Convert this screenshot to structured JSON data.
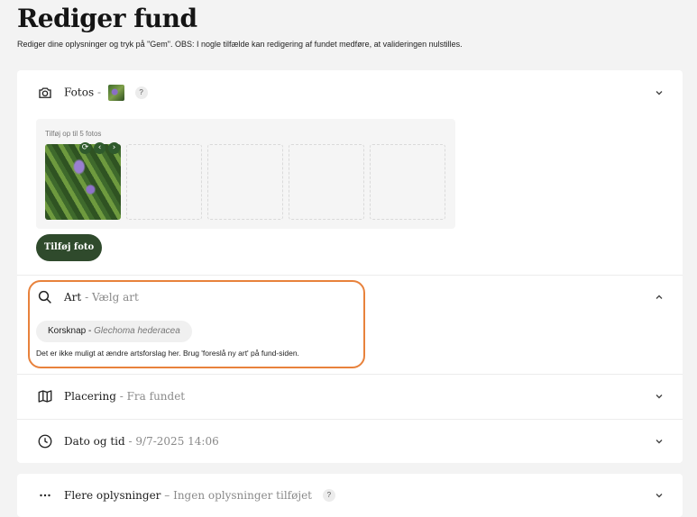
{
  "page": {
    "title": "Rediger fund",
    "subtitle": "Rediger dine oplysninger og tryk på \"Gem\". OBS: I nogle tilfælde kan redigering af fundet medføre, at valideringen nulstilles."
  },
  "photos": {
    "label": "Fotos",
    "separator": "-",
    "help": "?",
    "hint": "Tilføj op til 5 fotos",
    "max_photos": 5,
    "photo_count": 1,
    "add_button": "Tilføj foto",
    "icons": [
      "camera-icon",
      "refresh-icon",
      "chevron-left-icon",
      "chevron-right-icon",
      "chevron-down-icon"
    ]
  },
  "species": {
    "label": "Art",
    "separator": "-",
    "sub": "Vælg art",
    "common_name": "Korsknap",
    "chip_separator": " - ",
    "latin_name": "Glechoma hederacea",
    "note": "Det er ikke muligt at ændre artsforslag her. Brug 'foreslå ny art' på fund-siden.",
    "icon": "search-icon",
    "expanded": true
  },
  "location": {
    "label": "Placering",
    "separator": "-",
    "sub": "Fra fundet",
    "icon": "map-icon"
  },
  "datetime": {
    "label": "Dato og tid",
    "separator": "-",
    "sub": "9/7-2025 14:06",
    "icon": "clock-icon"
  },
  "more": {
    "label": "Flere oplysninger",
    "separator": "–",
    "sub": "Ingen oplysninger tilføjet",
    "help": "?",
    "icon": "ellipsis-icon"
  },
  "colors": {
    "accent": "#2f4a2c",
    "highlight": "#e8823c",
    "background": "#f3f3f3"
  }
}
